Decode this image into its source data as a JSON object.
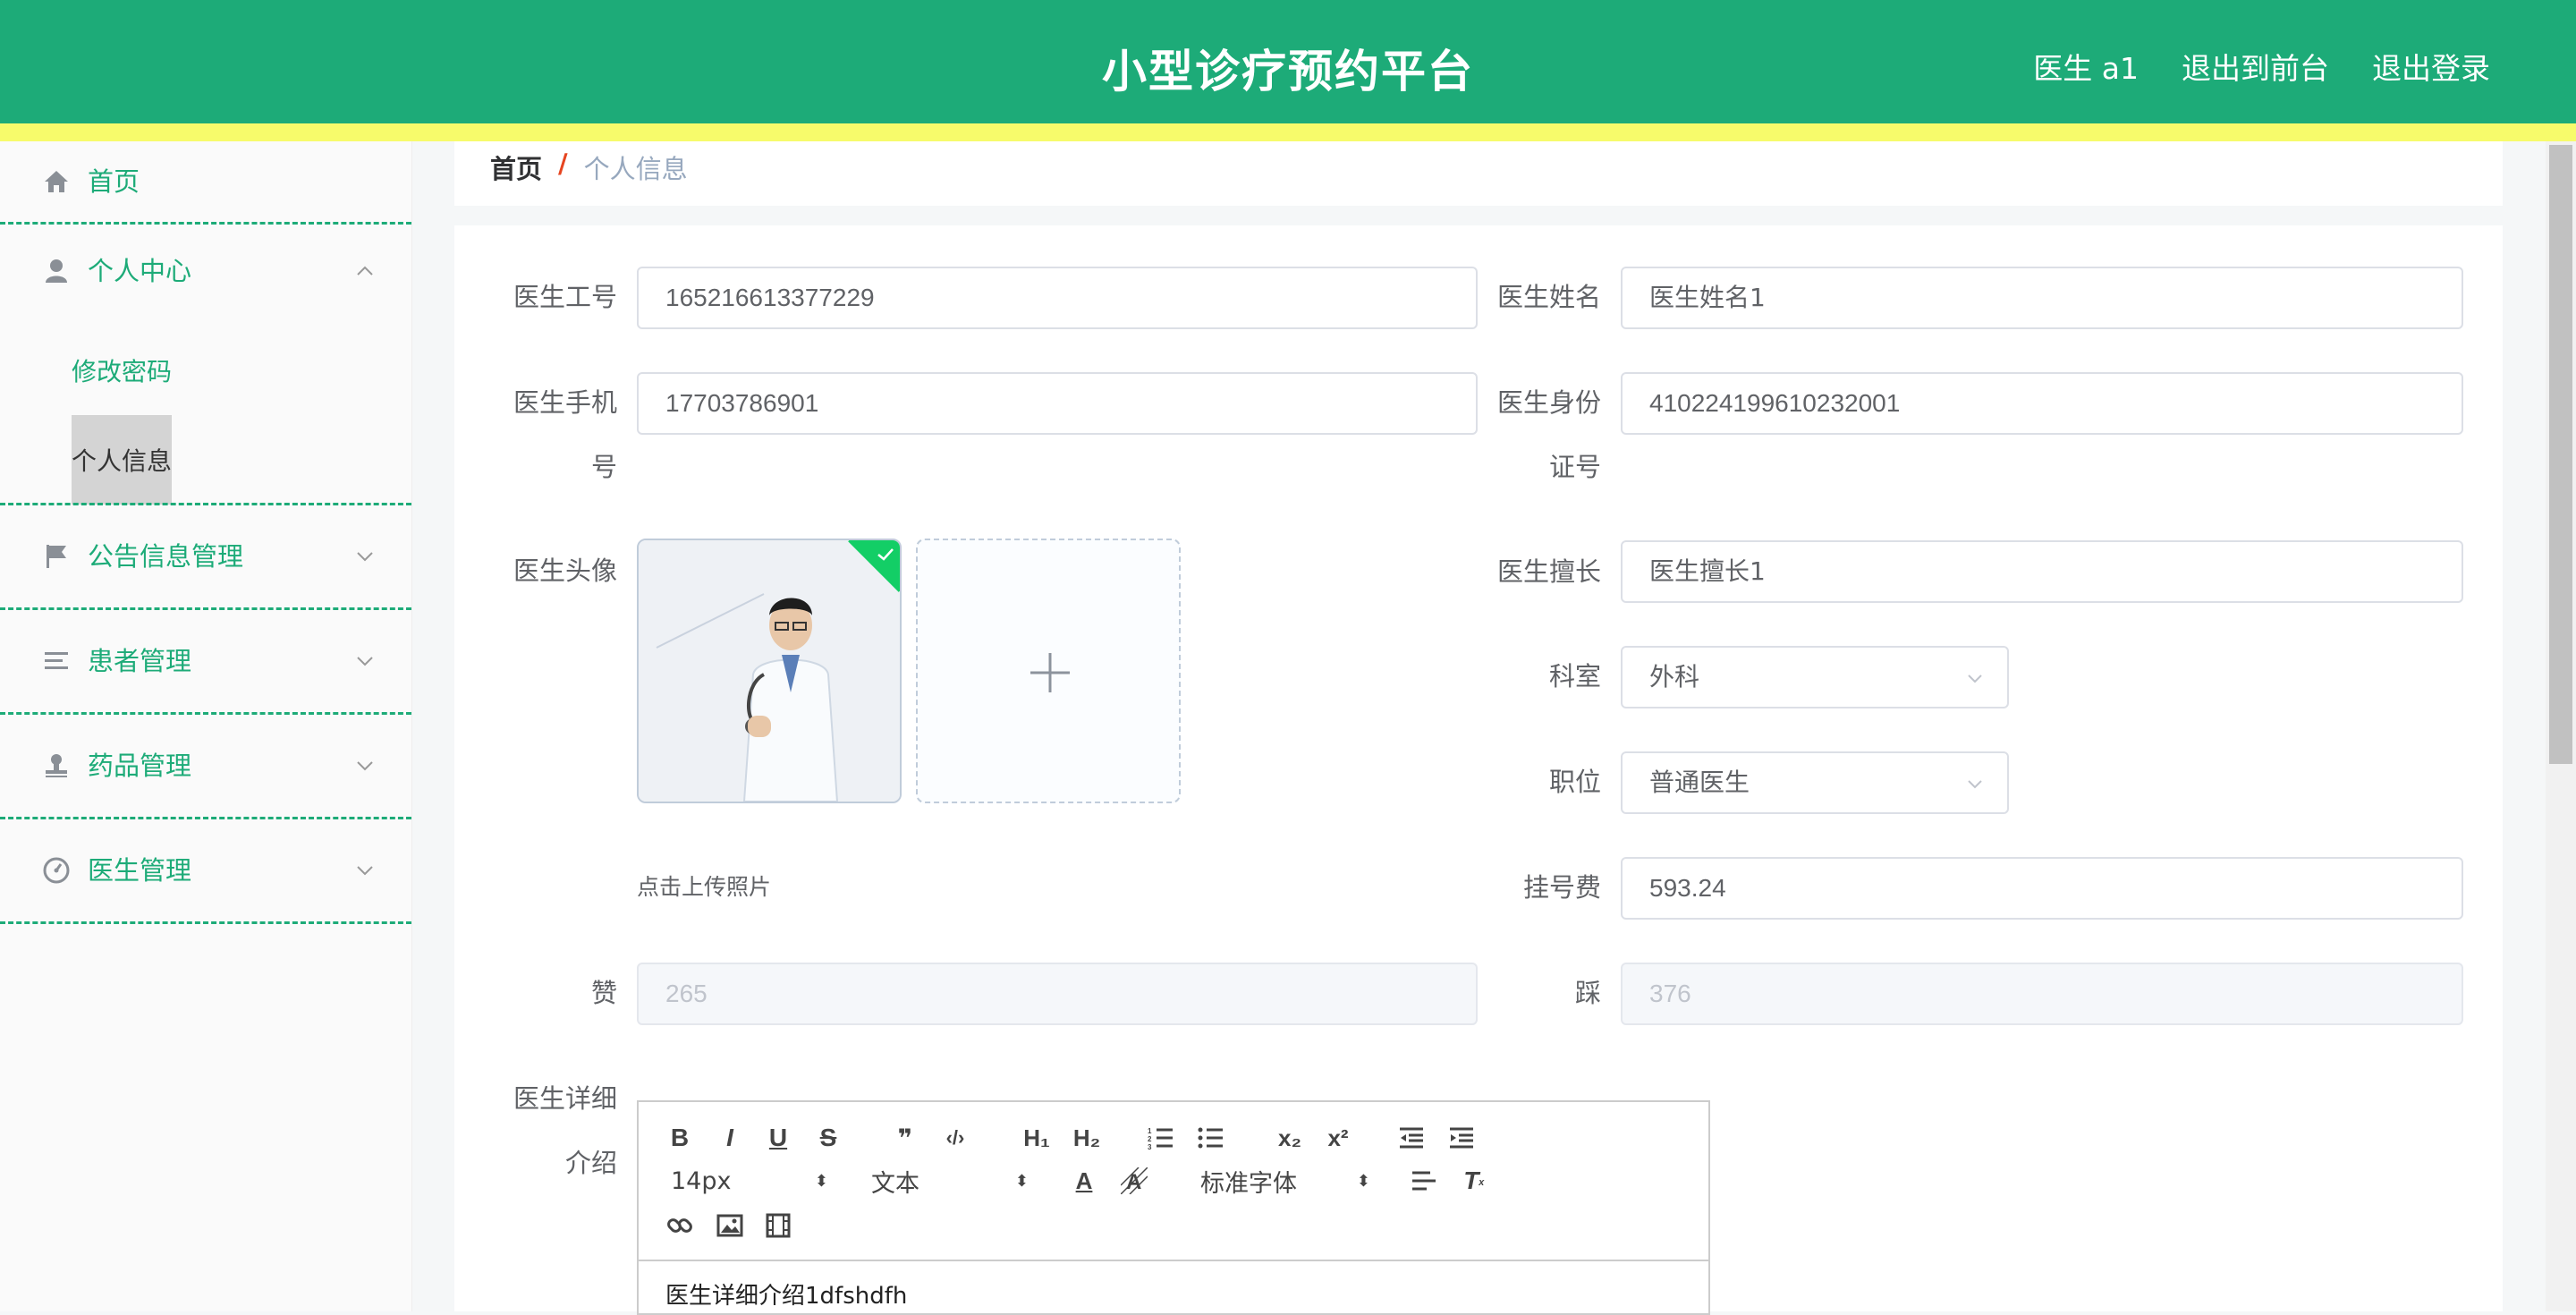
{
  "header": {
    "title": "小型诊疗预约平台",
    "nav": {
      "user": "医生 a1",
      "front": "退出到前台",
      "logout": "退出登录"
    }
  },
  "colors": {
    "primary": "#1dab78",
    "stripe": "#f7fb6b",
    "breadcrumb_sep": "#e64520"
  },
  "sidebar": {
    "items": [
      {
        "label": "首页",
        "icon": "home-icon"
      },
      {
        "label": "个人中心",
        "icon": "user-icon",
        "expanded": true,
        "children": [
          {
            "label": "修改密码"
          },
          {
            "label": "个人信息",
            "active": true
          }
        ]
      },
      {
        "label": "公告信息管理",
        "icon": "flag-icon"
      },
      {
        "label": "患者管理",
        "icon": "list-icon"
      },
      {
        "label": "药品管理",
        "icon": "stamp-icon"
      },
      {
        "label": "医生管理",
        "icon": "gauge-icon"
      }
    ]
  },
  "breadcrumb": {
    "home": "首页",
    "separator": "/",
    "current": "个人信息"
  },
  "form": {
    "doctor_id": {
      "label": "医生工号",
      "value": "165216613377229"
    },
    "doctor_name": {
      "label": "医生姓名",
      "value": "医生姓名1"
    },
    "phone": {
      "label_line1": "医生手机",
      "label_line2": "号",
      "value": "17703786901"
    },
    "id_card": {
      "label_line1": "医生身份",
      "label_line2": "证号",
      "value": "410224199610232001"
    },
    "avatar": {
      "label": "医生头像",
      "upload_tip": "点击上传照片",
      "plus": "+"
    },
    "specialty": {
      "label": "医生擅长",
      "value": "医生擅长1"
    },
    "department": {
      "label": "科室",
      "value": "外科"
    },
    "position": {
      "label": "职位",
      "value": "普通医生"
    },
    "fee": {
      "label": "挂号费",
      "value": "593.24"
    },
    "likes": {
      "label": "赞",
      "value": "265"
    },
    "dislikes": {
      "label": "踩",
      "value": "376"
    },
    "detail": {
      "label_line1": "医生详细",
      "label_line2": "介绍",
      "content": "医生详细介绍1dfshdfh",
      "toolbar": {
        "size": "14px",
        "header": "文本",
        "font": "标准字体"
      }
    }
  }
}
